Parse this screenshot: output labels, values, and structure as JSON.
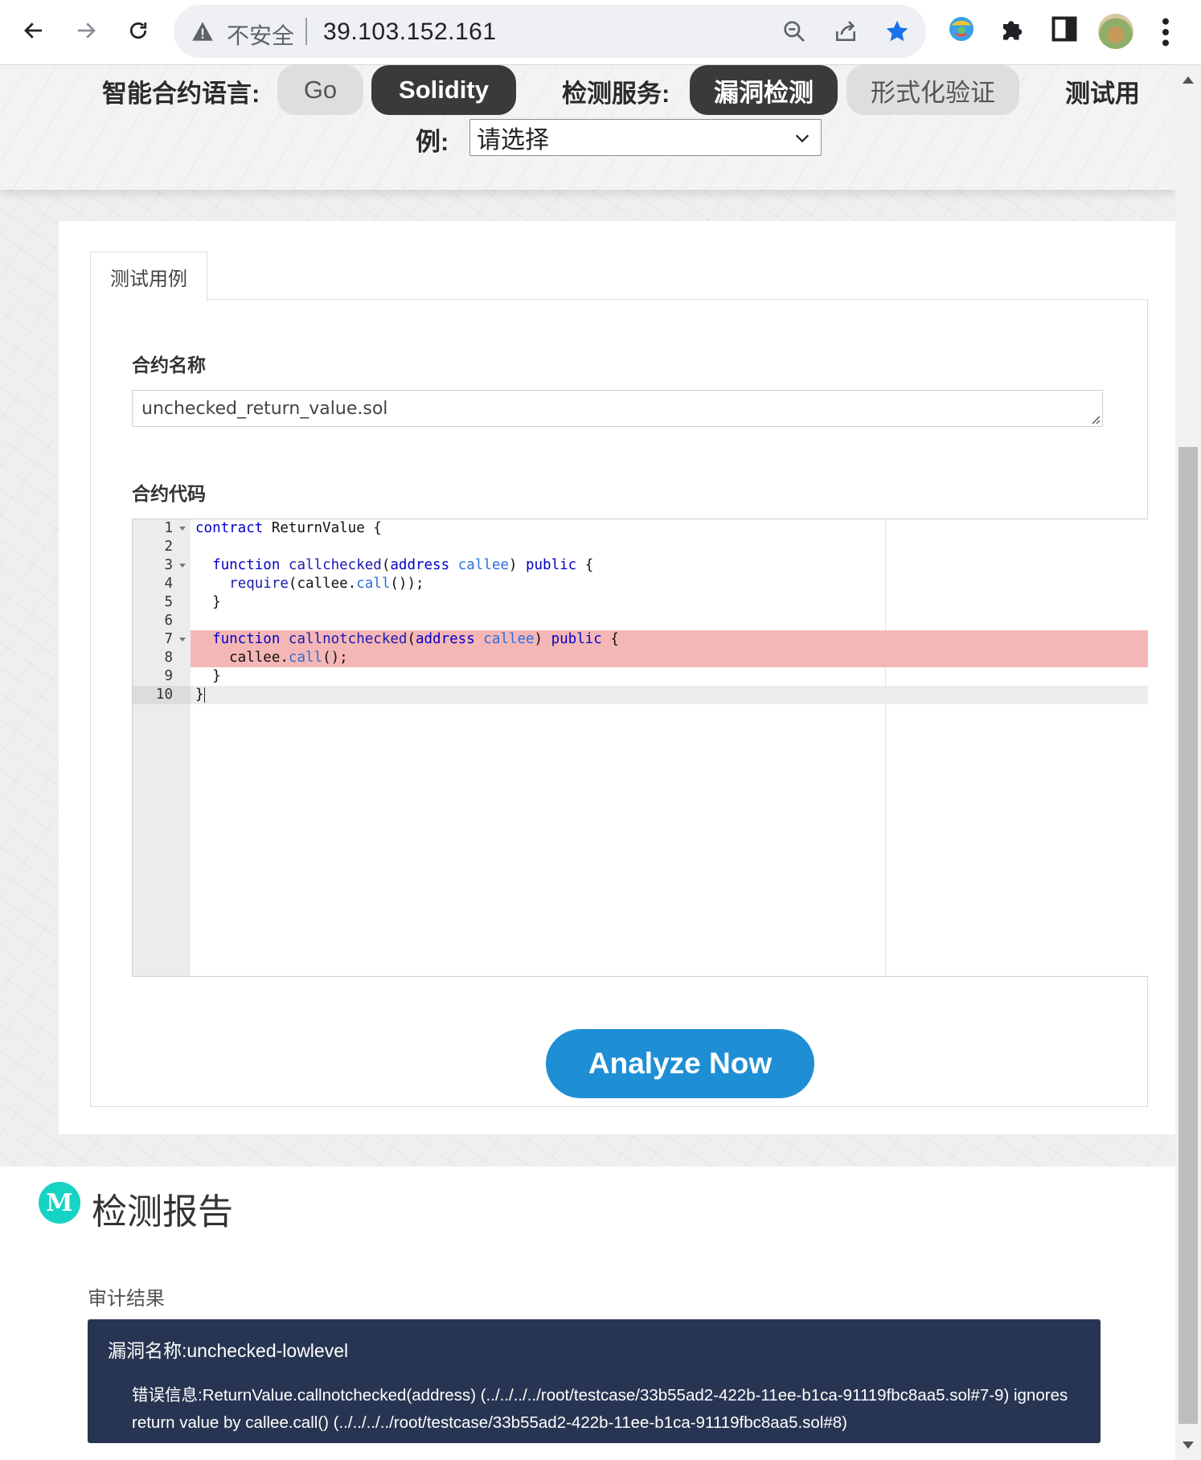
{
  "browser": {
    "security_label": "不安全",
    "url": "39.103.152.161"
  },
  "topbar": {
    "language_label": "智能合约语言:",
    "languages": [
      {
        "label": "Go",
        "selected": false
      },
      {
        "label": "Solidity",
        "selected": true
      }
    ],
    "service_label": "检测服务:",
    "services": [
      {
        "label": "漏洞检测",
        "selected": true
      },
      {
        "label": "形式化验证",
        "selected": false
      }
    ],
    "testcase_label_part1": "测试用",
    "testcase_label_part2": "例:",
    "testcase_select_value": "请选择"
  },
  "main": {
    "tab_label": "测试用例",
    "contract_name_label": "合约名称",
    "contract_name_value": "unchecked_return_value.sol",
    "contract_code_label": "合约代码",
    "analyze_button": "Analyze Now"
  },
  "code": {
    "line_numbers": [
      "1",
      "2",
      "3",
      "4",
      "5",
      "6",
      "7",
      "8",
      "9",
      "10"
    ],
    "highlighted_lines": [
      7,
      8
    ],
    "active_line": 10,
    "lines": [
      "contract ReturnValue {",
      "",
      "  function callchecked(address callee) public {",
      "    require(callee.call());",
      "  }",
      "",
      "  function callnotchecked(address callee) public {",
      "    callee.call();",
      "  }",
      "}"
    ]
  },
  "report": {
    "logo_letter": "M",
    "title": "检测报告",
    "audit_label": "审计结果",
    "vuln_name": "漏洞名称:unchecked-lowlevel",
    "vuln_message": "错误信息:ReturnValue.callnotchecked(address) (../../../../root/testcase/33b55ad2-422b-11ee-b1ca-91119fbc8aa5.sol#7-9) ignores return value by callee.call() (../../../../root/testcase/33b55ad2-422b-11ee-b1ca-91119fbc8aa5.sol#8)"
  },
  "colors": {
    "accent_button": "#1e8fd5",
    "result_box": "#283552",
    "error_highlight": "#f5b7b6",
    "report_logo": "#16d3c4",
    "bookmark_star": "#1a73e8"
  },
  "icons": [
    "back-arrow-icon",
    "forward-arrow-icon",
    "reload-icon",
    "warning-icon",
    "zoom-icon",
    "share-icon",
    "bookmark-star-icon",
    "extension-colorful-icon",
    "puzzle-icon",
    "side-panel-icon",
    "profile-avatar",
    "more-menu-icon",
    "chevron-down-icon"
  ]
}
